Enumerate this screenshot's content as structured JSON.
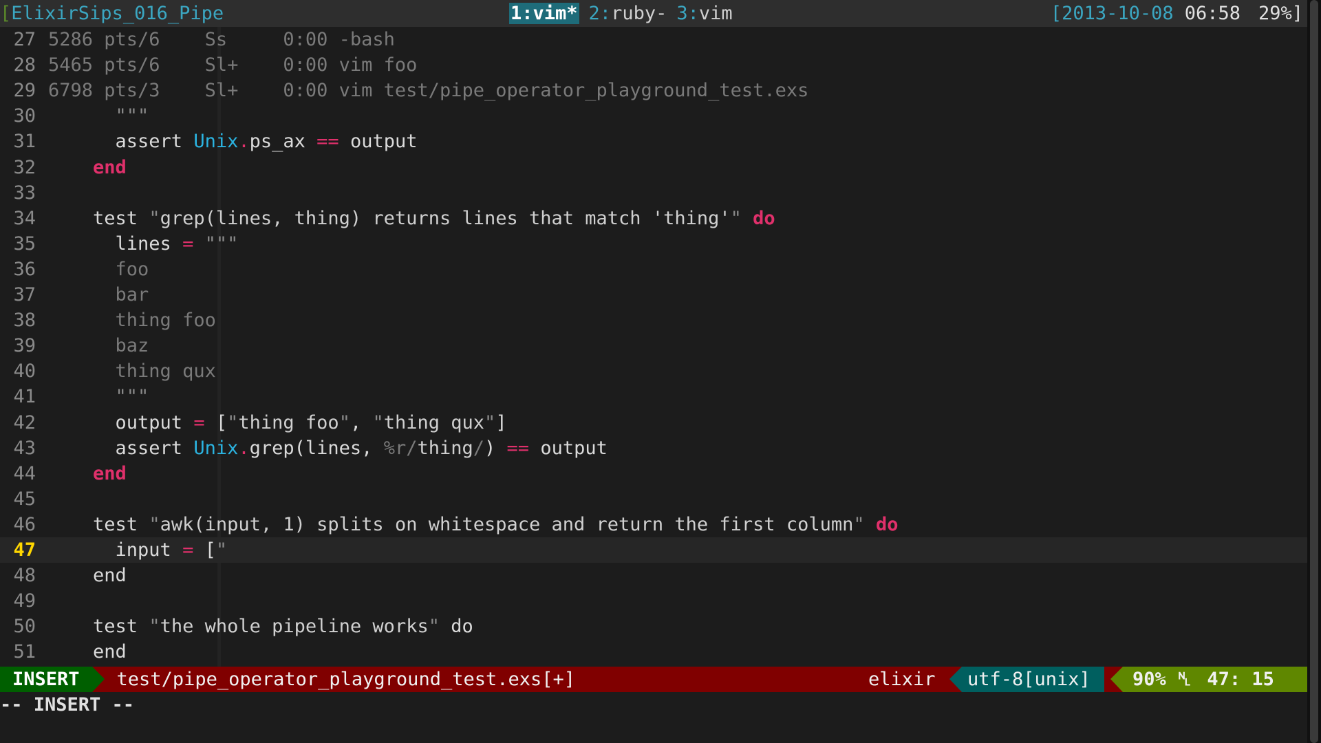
{
  "tmux": {
    "session_open": "[",
    "session_name": "ElixirSips_016_Pipe",
    "windows": [
      {
        "num": "1:",
        "name": "vim*",
        "active": true
      },
      {
        "num": "2:",
        "name": "ruby-",
        "active": false
      },
      {
        "num": "3:",
        "name": "vim",
        "active": false
      }
    ],
    "date": "[2013-10-08",
    "time": "06:58",
    "battery": "29%]"
  },
  "editor": {
    "lines": [
      {
        "n": "27",
        "segs": [
          [
            "t-dim",
            "5286 pts/6    Ss     0:00 -bash"
          ]
        ]
      },
      {
        "n": "28",
        "segs": [
          [
            "t-dim",
            "5465 pts/6    Sl+    0:00 vim foo"
          ]
        ]
      },
      {
        "n": "29",
        "segs": [
          [
            "t-dim",
            "6798 pts/3    Sl+    0:00 vim test/pipe_operator_playground_test.exs"
          ]
        ]
      },
      {
        "n": "30",
        "segs": [
          [
            "t-q",
            "      \"\"\""
          ]
        ]
      },
      {
        "n": "31",
        "segs": [
          [
            "t-plain",
            "      assert "
          ],
          [
            "t-mod",
            "Unix"
          ],
          [
            "t-op",
            "."
          ],
          [
            "t-plain",
            "ps_ax "
          ],
          [
            "t-op",
            "=="
          ],
          [
            "t-plain",
            " output"
          ]
        ]
      },
      {
        "n": "32",
        "segs": [
          [
            "t-plain",
            "    "
          ],
          [
            "t-kw",
            "end"
          ]
        ]
      },
      {
        "n": "33",
        "segs": []
      },
      {
        "n": "34",
        "segs": [
          [
            "t-plain",
            "    test "
          ],
          [
            "t-q",
            "\""
          ],
          [
            "t-str",
            "grep(lines, thing) returns lines that match 'thing'"
          ],
          [
            "t-q",
            "\""
          ],
          [
            "t-plain",
            " "
          ],
          [
            "t-kw",
            "do"
          ]
        ]
      },
      {
        "n": "35",
        "segs": [
          [
            "t-plain",
            "      lines "
          ],
          [
            "t-op",
            "="
          ],
          [
            "t-q",
            " \"\"\""
          ]
        ]
      },
      {
        "n": "36",
        "segs": [
          [
            "t-dim",
            "      foo"
          ]
        ]
      },
      {
        "n": "37",
        "segs": [
          [
            "t-dim",
            "      bar"
          ]
        ]
      },
      {
        "n": "38",
        "segs": [
          [
            "t-dim",
            "      thing foo"
          ]
        ]
      },
      {
        "n": "39",
        "segs": [
          [
            "t-dim",
            "      baz"
          ]
        ]
      },
      {
        "n": "40",
        "segs": [
          [
            "t-dim",
            "      thing qux"
          ]
        ]
      },
      {
        "n": "41",
        "segs": [
          [
            "t-q",
            "      \"\"\""
          ]
        ]
      },
      {
        "n": "42",
        "segs": [
          [
            "t-plain",
            "      output "
          ],
          [
            "t-op",
            "="
          ],
          [
            "t-plain",
            " ["
          ],
          [
            "t-q",
            "\""
          ],
          [
            "t-str",
            "thing foo"
          ],
          [
            "t-q",
            "\""
          ],
          [
            "t-plain",
            ", "
          ],
          [
            "t-q",
            "\""
          ],
          [
            "t-str",
            "thing qux"
          ],
          [
            "t-q",
            "\""
          ],
          [
            "t-plain",
            "]"
          ]
        ]
      },
      {
        "n": "43",
        "segs": [
          [
            "t-plain",
            "      assert "
          ],
          [
            "t-mod",
            "Unix"
          ],
          [
            "t-op",
            "."
          ],
          [
            "t-plain",
            "grep(lines, "
          ],
          [
            "t-dim",
            "%r/"
          ],
          [
            "t-str",
            "thing"
          ],
          [
            "t-dim",
            "/"
          ],
          [
            "t-plain",
            ") "
          ],
          [
            "t-op",
            "=="
          ],
          [
            "t-plain",
            " output"
          ]
        ]
      },
      {
        "n": "44",
        "segs": [
          [
            "t-plain",
            "    "
          ],
          [
            "t-kw",
            "end"
          ]
        ]
      },
      {
        "n": "45",
        "segs": []
      },
      {
        "n": "46",
        "segs": [
          [
            "t-plain",
            "    test "
          ],
          [
            "t-q",
            "\""
          ],
          [
            "t-str",
            "awk(input, 1) splits on whitespace and return the first column"
          ],
          [
            "t-q",
            "\""
          ],
          [
            "t-plain",
            " "
          ],
          [
            "t-kw",
            "do"
          ]
        ]
      },
      {
        "n": "47",
        "current": true,
        "segs": [
          [
            "t-plain",
            "      input "
          ],
          [
            "t-op",
            "="
          ],
          [
            "t-plain",
            " ["
          ],
          [
            "t-q",
            "\""
          ]
        ]
      },
      {
        "n": "48",
        "segs": [
          [
            "t-plain",
            "    end"
          ]
        ]
      },
      {
        "n": "49",
        "segs": []
      },
      {
        "n": "50",
        "segs": [
          [
            "t-plain",
            "    test "
          ],
          [
            "t-q",
            "\""
          ],
          [
            "t-str",
            "the whole pipeline works"
          ],
          [
            "t-q",
            "\""
          ],
          [
            "t-plain",
            " do"
          ]
        ]
      },
      {
        "n": "51",
        "segs": [
          [
            "t-plain",
            "    end"
          ]
        ]
      }
    ]
  },
  "statusline": {
    "mode": "INSERT",
    "file": "test/pipe_operator_playground_test.exs[+]",
    "filetype": "elixir",
    "encoding": "utf-8[unix]",
    "percent": "90%",
    "line_glyph": "␤",
    "position": "47: 15"
  },
  "cmdline": "-- INSERT --",
  "colors": {
    "insert_mode": "#005f00",
    "statusline": "#800000",
    "keyword": "#e0306b",
    "module": "#2bb3e0"
  }
}
